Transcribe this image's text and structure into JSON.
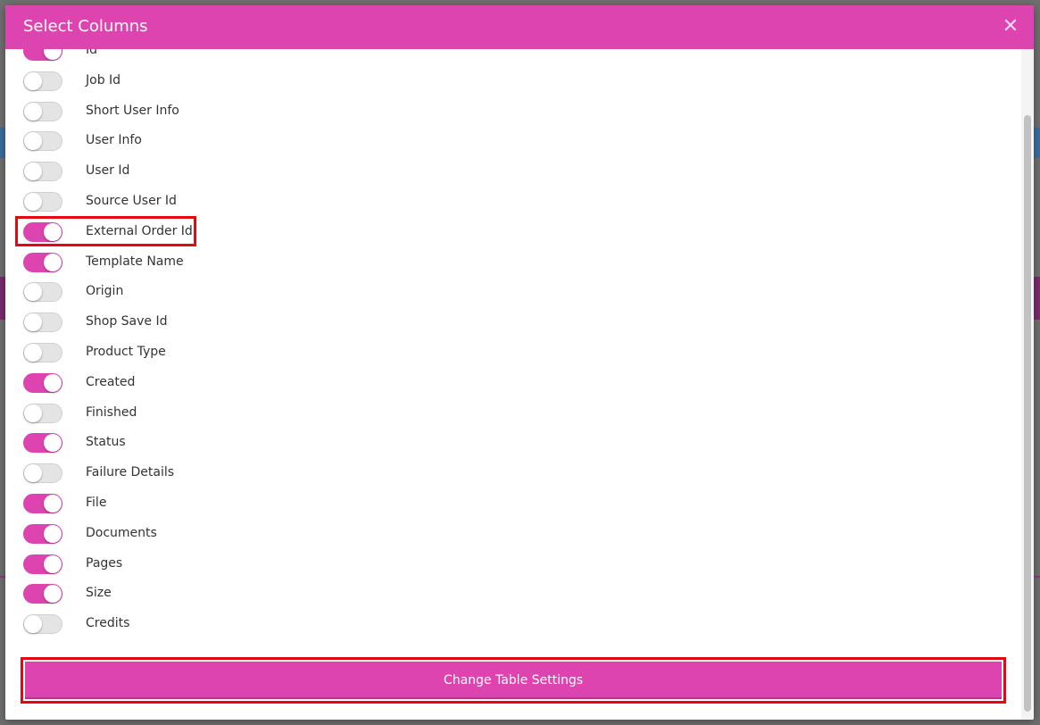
{
  "modal": {
    "title": "Select Columns",
    "close_icon": "close-icon",
    "submit_label": "Change Table Settings"
  },
  "colors": {
    "accent": "#dd44b0",
    "highlight": "#e30613"
  },
  "columns": [
    {
      "label": "Id",
      "enabled": true
    },
    {
      "label": "Job Id",
      "enabled": false
    },
    {
      "label": "Short User Info",
      "enabled": false
    },
    {
      "label": "User Info",
      "enabled": false
    },
    {
      "label": "User Id",
      "enabled": false
    },
    {
      "label": "Source User Id",
      "enabled": false
    },
    {
      "label": "External Order Id",
      "enabled": true
    },
    {
      "label": "Template Name",
      "enabled": true
    },
    {
      "label": "Origin",
      "enabled": false
    },
    {
      "label": "Shop Save Id",
      "enabled": false
    },
    {
      "label": "Product Type",
      "enabled": false
    },
    {
      "label": "Created",
      "enabled": true
    },
    {
      "label": "Finished",
      "enabled": false
    },
    {
      "label": "Status",
      "enabled": true
    },
    {
      "label": "Failure Details",
      "enabled": false
    },
    {
      "label": "File",
      "enabled": true
    },
    {
      "label": "Documents",
      "enabled": true
    },
    {
      "label": "Pages",
      "enabled": true
    },
    {
      "label": "Size",
      "enabled": true
    },
    {
      "label": "Credits",
      "enabled": false
    }
  ]
}
